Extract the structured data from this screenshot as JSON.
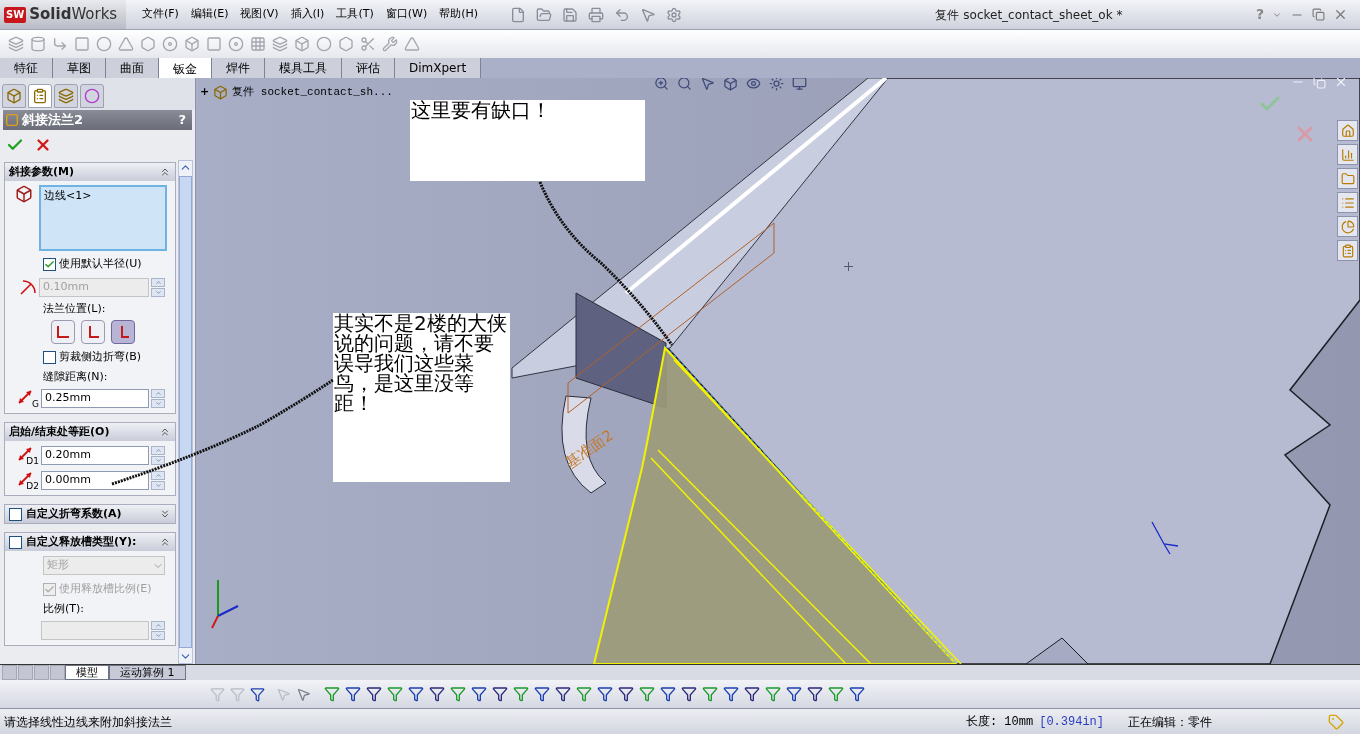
{
  "app": {
    "logo_badge": "SW",
    "logo": "**Solid**Works",
    "menu": [
      "文件(F)",
      "编辑(E)",
      "视图(V)",
      "插入(I)",
      "工具(T)",
      "窗口(W)",
      "帮助(H)"
    ],
    "document_title": "复件 socket_contact_sheet_ok *",
    "help": "?"
  },
  "command_tabs": [
    {
      "label": "特征",
      "selected": false
    },
    {
      "label": "草图",
      "selected": false
    },
    {
      "label": "曲面",
      "selected": false
    },
    {
      "label": "钣金",
      "selected": true
    },
    {
      "label": "焊件",
      "selected": false
    },
    {
      "label": "模具工具",
      "selected": false
    },
    {
      "label": "评估",
      "selected": false
    },
    {
      "label": "DimXpert",
      "selected": false
    }
  ],
  "panel_tabs": [
    {
      "selected": false
    },
    {
      "selected": true
    },
    {
      "selected": false
    },
    {
      "selected": false
    }
  ],
  "property_manager": {
    "title": "斜接法兰2",
    "help": "?",
    "groups": [
      {
        "title": "斜接参数(M)",
        "expanded": true,
        "rows": [
          {
            "kind": "selection_list",
            "items": [
              "边线<1>"
            ]
          },
          {
            "kind": "checkbox",
            "label": "使用默认半径(U)",
            "checked": true,
            "disabled": false
          },
          {
            "kind": "radius_field",
            "value": "0.10mm",
            "disabled": true
          },
          {
            "kind": "label",
            "text": "法兰位置(L):"
          },
          {
            "kind": "position_buttons",
            "options": [
              {
                "selected": false
              },
              {
                "selected": false
              },
              {
                "selected": true
              }
            ]
          },
          {
            "kind": "checkbox",
            "label": "剪裁侧边折弯(B)",
            "checked": false,
            "disabled": false
          },
          {
            "kind": "label",
            "text": "缝隙距离(N):"
          },
          {
            "kind": "distance_field",
            "icon_label": "G",
            "value": "0.25mm",
            "disabled": false
          }
        ]
      },
      {
        "title": "启始/结束处等距(O)",
        "expanded": true,
        "rows": [
          {
            "kind": "distance_field",
            "icon_label": "D1",
            "value": "0.20mm",
            "disabled": false
          },
          {
            "kind": "distance_field",
            "icon_label": "D2",
            "value": "0.00mm",
            "disabled": false
          }
        ]
      },
      {
        "title": "自定义折弯系数(A)",
        "checkbox": {
          "checked": false
        },
        "expanded": false
      },
      {
        "title": "自定义释放槽类型(Y):",
        "checkbox": {
          "checked": false
        },
        "expanded": true,
        "rows": [
          {
            "kind": "dropdown",
            "value": "矩形",
            "disabled": true
          },
          {
            "kind": "checkbox",
            "label": "使用释放槽比例(E)",
            "checked": true,
            "disabled": true
          },
          {
            "kind": "label",
            "text": "比例(T):"
          },
          {
            "kind": "blank_field",
            "disabled": true
          }
        ]
      }
    ]
  },
  "feature_tree": {
    "expander": "+",
    "root": "复件 socket_contact_sh..."
  },
  "annotations": [
    {
      "text": "这里要有缺口！"
    },
    {
      "text": "其实不是2楼的大侠说的问题，请不要误导我们这些菜鸟，是这里没等距！"
    }
  ],
  "model_label": "基准面2",
  "bottom_tabs": [
    {
      "label": "模型",
      "selected": true
    },
    {
      "label": "运动算例 1",
      "selected": false
    }
  ],
  "status_bar": {
    "message": "请选择线性边线来附加斜接法兰",
    "length_label": "长度: 10mm",
    "length_alt": "[0.394in]",
    "editing": "正在编辑：零件"
  }
}
